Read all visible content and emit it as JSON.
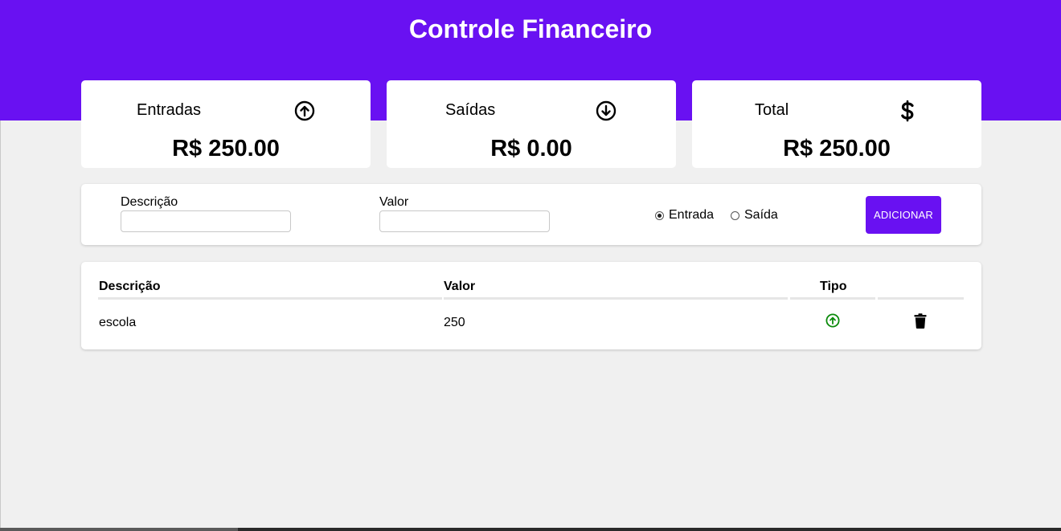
{
  "app": {
    "title": "Controle Financeiro"
  },
  "summary": {
    "income": {
      "label": "Entradas",
      "amount": "R$ 250.00",
      "icon": "arrow-up-circle-icon"
    },
    "expense": {
      "label": "Saídas",
      "amount": "R$ 0.00",
      "icon": "arrow-down-circle-icon"
    },
    "total": {
      "label": "Total",
      "amount": "R$ 250.00",
      "icon": "dollar-icon"
    }
  },
  "form": {
    "description_label": "Descrição",
    "description_value": "",
    "value_label": "Valor",
    "value_value": "",
    "type_options": [
      "Entrada",
      "Saída"
    ],
    "type_selected": "Entrada",
    "add_button": "ADICIONAR"
  },
  "table": {
    "headers": [
      "Descrição",
      "Valor",
      "Tipo"
    ],
    "rows": [
      {
        "description": "escola",
        "value": "250",
        "type_icon": "arrow-up-circle-icon",
        "type": "Entrada",
        "action_icon": "trash-icon"
      }
    ]
  },
  "colors": {
    "accent": "#6911f2",
    "income_icon": "#0a8a0a",
    "background": "#f0f0f0"
  }
}
